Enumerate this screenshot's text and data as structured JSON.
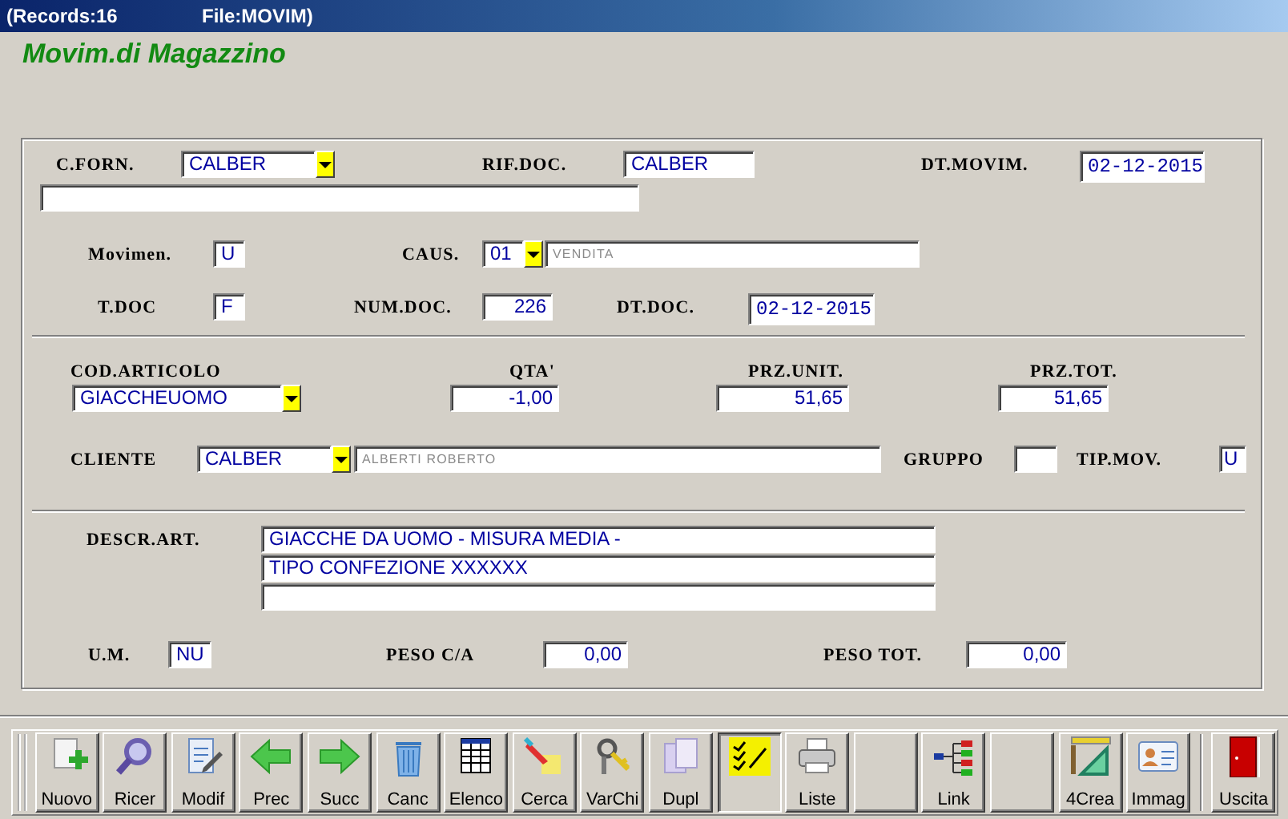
{
  "title_bar": {
    "records": "(Records:16",
    "file": "File:MOVIM)"
  },
  "heading": "Movim.di Magazzino",
  "document": {
    "supplier": {
      "label": "C.FORN.",
      "value": "CALBER"
    },
    "doc_ref": {
      "label": "RIF.DOC.",
      "value": "CALBER"
    },
    "movement_date": {
      "label": "DT.MOVIM.",
      "value": "02-12-2015"
    },
    "movement": {
      "label": "Movimen.",
      "value": "U"
    },
    "reason": {
      "label": "CAUS.",
      "value": "01",
      "description": "VENDITA"
    },
    "doc_type": {
      "label": "T.DOC",
      "value": "F"
    },
    "doc_number": {
      "label": "NUM.DOC.",
      "value": "226"
    },
    "doc_date": {
      "label": "DT.DOC.",
      "value": "02-12-2015"
    }
  },
  "line": {
    "article": {
      "label": "COD.ARTICOLO",
      "value": "GIACCHEUOMO"
    },
    "quantity": {
      "label": "QTA'",
      "value": "-1,00"
    },
    "unit_price": {
      "label": "PRZ.UNIT.",
      "value": "51,65"
    },
    "total_price": {
      "label": "PRZ.TOT.",
      "value": "51,65"
    },
    "customer": {
      "label": "CLIENTE",
      "value": "CALBER",
      "description": "ALBERTI ROBERTO"
    },
    "group": {
      "label": "GRUPPO"
    },
    "movement_type": {
      "label": "TIP.MOV.",
      "value": "U"
    }
  },
  "details": {
    "description": {
      "label": "DESCR.ART.",
      "lines": [
        "GIACCHE DA UOMO - MISURA MEDIA -",
        "TIPO CONFEZIONE XXXXXX"
      ]
    },
    "unit": {
      "label": "U.M.",
      "value": "NU"
    },
    "weight_each": {
      "label": "PESO C/A",
      "value": "0,00"
    },
    "weight_total": {
      "label": "PESO TOT.",
      "value": "0,00"
    }
  },
  "toolbar": [
    {
      "kind": "new",
      "label": "Nuovo",
      "pressed": false
    },
    {
      "kind": "search",
      "label": "Ricer",
      "pressed": false
    },
    {
      "kind": "edit",
      "label": "Modif",
      "pressed": false
    },
    {
      "kind": "prev",
      "label": "Prec",
      "pressed": false
    },
    {
      "kind": "next",
      "label": "Succ",
      "pressed": false
    },
    {
      "kind": "delete",
      "label": "Canc",
      "pressed": false
    },
    {
      "kind": "list",
      "label": "Elenco",
      "pressed": false
    },
    {
      "kind": "find",
      "label": "Cerca",
      "pressed": false
    },
    {
      "kind": "keys",
      "label": "VarChi",
      "pressed": false
    },
    {
      "kind": "copy",
      "label": "Dupl",
      "pressed": false
    },
    {
      "kind": "checklist",
      "pressed": true
    },
    {
      "kind": "print",
      "label": "Liste",
      "pressed": false
    },
    {
      "kind": "blank",
      "pressed": false
    },
    {
      "kind": "tree",
      "label": "Link",
      "pressed": false
    },
    {
      "kind": "blank",
      "pressed": false
    },
    {
      "kind": "ruler",
      "label": "4Crea",
      "pressed": false
    },
    {
      "kind": "card",
      "label": "Immag",
      "pressed": false
    },
    {
      "kind": "exit",
      "label": "Uscita",
      "pressed": false
    }
  ]
}
